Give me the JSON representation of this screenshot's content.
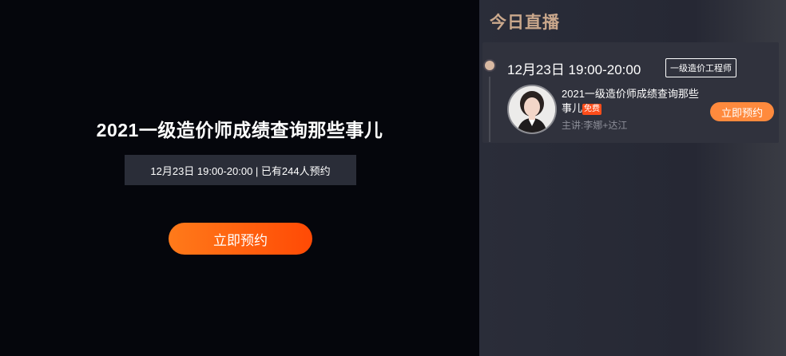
{
  "main": {
    "title": "2021一级造价师成绩查询那些事儿",
    "meta": "12月23日 19:00-20:00 | 已有244人预约",
    "cta_label": "立即预约"
  },
  "sidebar": {
    "heading": "今日直播",
    "live": {
      "time": "12月23日 19:00-20:00",
      "tag": "一级造价工程师",
      "title": "2021一级造价师成绩查询那些事儿",
      "free_badge": "免费",
      "lecturer": "主讲:李娜+达江",
      "button_label": "立即预约"
    }
  },
  "colors": {
    "accent": "#ff5a10",
    "heading": "#caa88c",
    "button_right": "#ff8a3d",
    "free_badge": "#ff4d1a"
  }
}
